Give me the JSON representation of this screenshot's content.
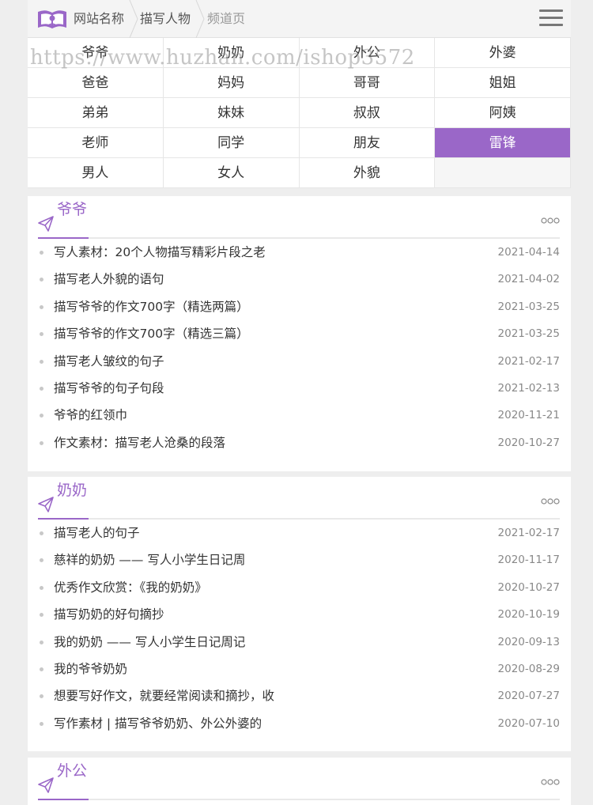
{
  "header": {
    "site_name": "网站名称",
    "category": "描写人物",
    "current": "频道页"
  },
  "categories": [
    {
      "label": "爷爷",
      "active": false
    },
    {
      "label": "奶奶",
      "active": false
    },
    {
      "label": "外公",
      "active": false
    },
    {
      "label": "外婆",
      "active": false
    },
    {
      "label": "爸爸",
      "active": false
    },
    {
      "label": "妈妈",
      "active": false
    },
    {
      "label": "哥哥",
      "active": false
    },
    {
      "label": "姐姐",
      "active": false
    },
    {
      "label": "弟弟",
      "active": false
    },
    {
      "label": "妹妹",
      "active": false
    },
    {
      "label": "叔叔",
      "active": false
    },
    {
      "label": "阿姨",
      "active": false
    },
    {
      "label": "老师",
      "active": false
    },
    {
      "label": "同学",
      "active": false
    },
    {
      "label": "朋友",
      "active": false
    },
    {
      "label": "雷锋",
      "active": true
    },
    {
      "label": "男人",
      "active": false
    },
    {
      "label": "女人",
      "active": false
    },
    {
      "label": "外貌",
      "active": false
    }
  ],
  "sections": [
    {
      "title": "爷爷",
      "items": [
        {
          "title": "写人素材：20个人物描写精彩片段之老",
          "date": "2021-04-14"
        },
        {
          "title": "描写老人外貌的语句",
          "date": "2021-04-02"
        },
        {
          "title": "描写爷爷的作文700字（精选两篇）",
          "date": "2021-03-25"
        },
        {
          "title": "描写爷爷的作文700字（精选三篇）",
          "date": "2021-03-25"
        },
        {
          "title": "描写老人皱纹的句子",
          "date": "2021-02-17"
        },
        {
          "title": "描写爷爷的句子句段",
          "date": "2021-02-13"
        },
        {
          "title": "爷爷的红领巾",
          "date": "2020-11-21"
        },
        {
          "title": "作文素材：描写老人沧桑的段落",
          "date": "2020-10-27"
        }
      ]
    },
    {
      "title": "奶奶",
      "items": [
        {
          "title": "描写老人的句子",
          "date": "2021-02-17"
        },
        {
          "title": "慈祥的奶奶 —— 写人小学生日记周",
          "date": "2020-11-17"
        },
        {
          "title": "优秀作文欣赏：《我的奶奶》",
          "date": "2020-10-27"
        },
        {
          "title": "描写奶奶的好句摘抄",
          "date": "2020-10-19"
        },
        {
          "title": "我的奶奶 —— 写人小学生日记周记",
          "date": "2020-09-13"
        },
        {
          "title": "我的爷爷奶奶",
          "date": "2020-08-29"
        },
        {
          "title": "想要写好作文，就要经常阅读和摘抄，收",
          "date": "2020-07-27"
        },
        {
          "title": "写作素材 | 描写爷爷奶奶、外公外婆的",
          "date": "2020-07-10"
        }
      ]
    },
    {
      "title": "外公",
      "items": []
    }
  ],
  "watermark": "https://www.huzhan.com/ishop3572",
  "colors": {
    "accent": "#9a67c8",
    "bg": "#eeeeee"
  }
}
